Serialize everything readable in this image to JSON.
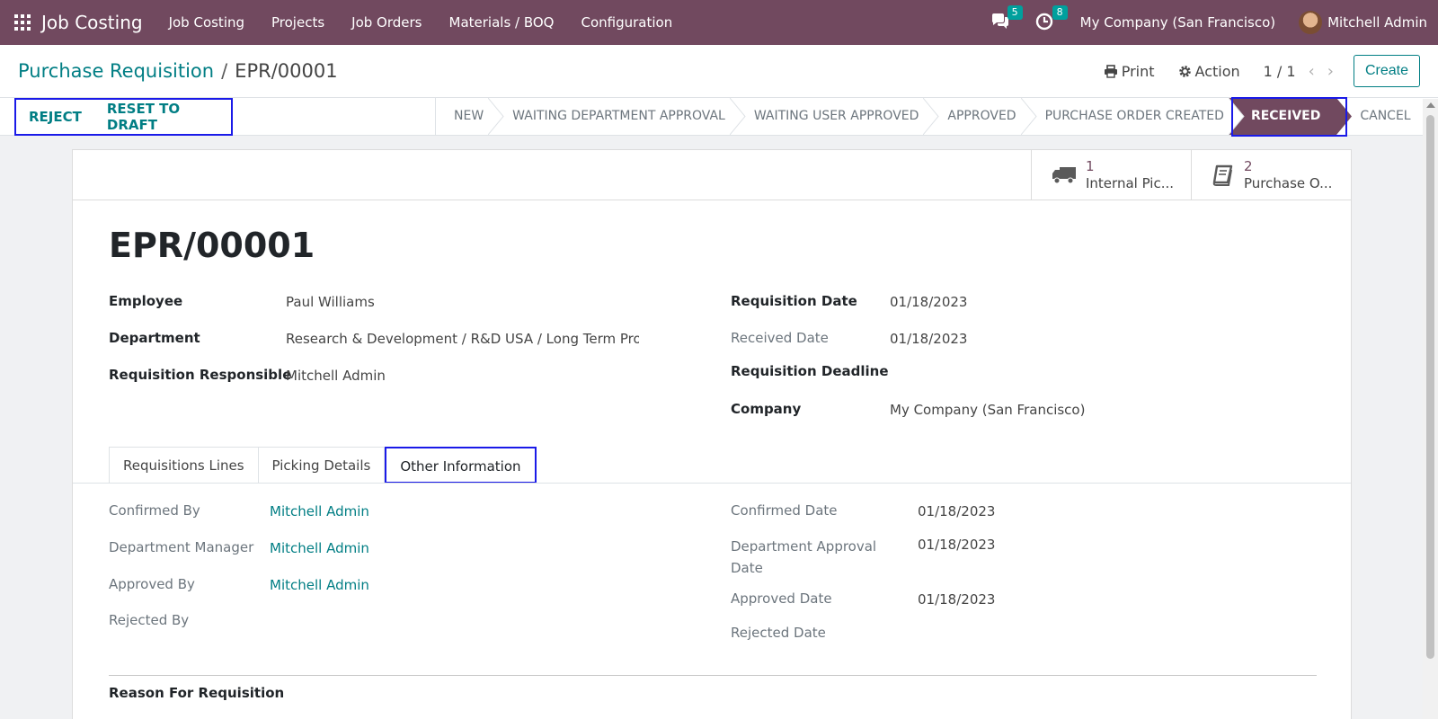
{
  "navbar": {
    "app_name": "Job Costing",
    "menu": [
      "Job Costing",
      "Projects",
      "Job Orders",
      "Materials / BOQ",
      "Configuration"
    ],
    "messages_count": "5",
    "activities_count": "8",
    "company": "My Company (San Francisco)",
    "user": "Mitchell Admin"
  },
  "control_panel": {
    "breadcrumb_parent": "Purchase Requisition",
    "breadcrumb_separator": "/",
    "breadcrumb_current": "EPR/00001",
    "print_label": "Print",
    "action_label": "Action",
    "pager": "1 / 1",
    "create_label": "Create"
  },
  "statusbar": {
    "buttons": [
      "REJECT",
      "RESET TO DRAFT"
    ],
    "stages": [
      "NEW",
      "WAITING DEPARTMENT APPROVAL",
      "WAITING USER APPROVED",
      "APPROVED",
      "PURCHASE ORDER CREATED",
      "RECEIVED",
      "CANCEL"
    ],
    "active_stage": "RECEIVED",
    "accent_color": "#71495f"
  },
  "smart_buttons": [
    {
      "icon": "truck-icon",
      "count": "1",
      "label": "Internal Pic..."
    },
    {
      "icon": "book-icon",
      "count": "2",
      "label": "Purchase O..."
    }
  ],
  "form": {
    "title": "EPR/00001",
    "left": [
      {
        "label": "Employee",
        "value": "Paul Williams"
      },
      {
        "label": "Department",
        "value": "Research & Development / R&D USA / Long Term Proje"
      },
      {
        "label": "Requisition Responsible",
        "value": "Mitchell Admin"
      }
    ],
    "right": [
      {
        "label": "Requisition Date",
        "value": "01/18/2023"
      },
      {
        "label": "Received Date",
        "value": "01/18/2023"
      },
      {
        "label": "Requisition Deadline",
        "value": ""
      },
      {
        "label": "Company",
        "value": "My Company (San Francisco)"
      }
    ]
  },
  "tabs": {
    "items": [
      "Requisitions Lines",
      "Picking Details",
      "Other Information"
    ],
    "active": "Other Information"
  },
  "other_info": {
    "left": [
      {
        "label": "Confirmed By",
        "value": "Mitchell Admin"
      },
      {
        "label": "Department Manager",
        "value": "Mitchell Admin"
      },
      {
        "label": "Approved By",
        "value": "Mitchell Admin"
      },
      {
        "label": "Rejected By",
        "value": ""
      }
    ],
    "right": [
      {
        "label": "Confirmed Date",
        "value": "01/18/2023"
      },
      {
        "label": "Department Approval Date",
        "value": "01/18/2023"
      },
      {
        "label": "Approved Date",
        "value": "01/18/2023"
      },
      {
        "label": "Rejected Date",
        "value": ""
      }
    ],
    "reason_label": "Reason For Requisition"
  }
}
